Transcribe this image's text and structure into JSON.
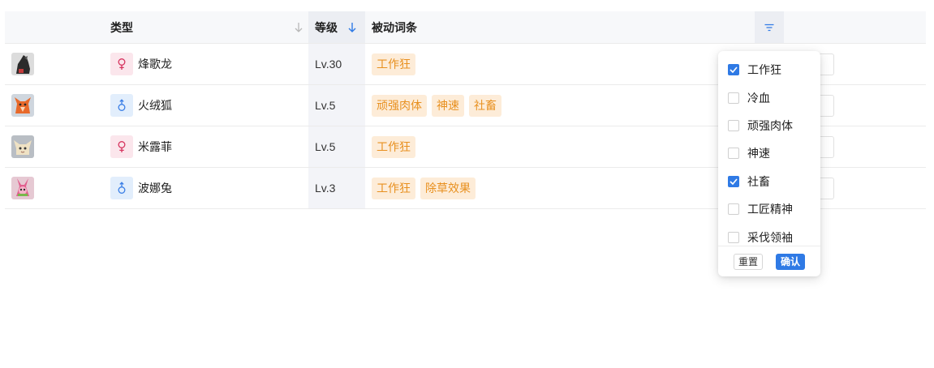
{
  "table": {
    "columns": {
      "type": "类型",
      "level": "等级",
      "traits": "被动词条"
    },
    "rows": [
      {
        "name": "烽歌龙",
        "gender": "female",
        "gender_icon": "female-icon",
        "level": "Lv.30",
        "traits": [
          "工作狂"
        ],
        "avatar_icon": "dark-dragon-avatar",
        "avatar_color": "#2b2b2b"
      },
      {
        "name": "火绒狐",
        "gender": "male",
        "gender_icon": "male-icon",
        "level": "Lv.5",
        "traits": [
          "顽强肉体",
          "神速",
          "社畜"
        ],
        "avatar_icon": "fire-fox-avatar",
        "avatar_color": "#e8692a"
      },
      {
        "name": "米露菲",
        "gender": "female",
        "gender_icon": "female-icon",
        "level": "Lv.5",
        "traits": [
          "工作狂"
        ],
        "avatar_icon": "cream-creature-avatar",
        "avatar_color": "#efe2c4"
      },
      {
        "name": "波娜兔",
        "gender": "male",
        "gender_icon": "male-icon",
        "level": "Lv.3",
        "traits": [
          "工作狂",
          "除草效果"
        ],
        "avatar_icon": "pink-bunny-avatar",
        "avatar_color": "#e1608f"
      }
    ]
  },
  "filter": {
    "icon": "filter-icon",
    "options": [
      {
        "label": "工作狂",
        "checked": true
      },
      {
        "label": "冷血",
        "checked": false
      },
      {
        "label": "顽强肉体",
        "checked": false
      },
      {
        "label": "神速",
        "checked": false
      },
      {
        "label": "社畜",
        "checked": true
      },
      {
        "label": "工匠精神",
        "checked": false
      },
      {
        "label": "采伐领袖",
        "checked": false
      }
    ],
    "reset_label": "重置",
    "confirm_label": "确认"
  },
  "colors": {
    "accent": "#2f7ae5",
    "tag_bg": "#fdecd8",
    "tag_text": "#e8901f",
    "female": "#d6335e",
    "male": "#3a7ee6"
  }
}
